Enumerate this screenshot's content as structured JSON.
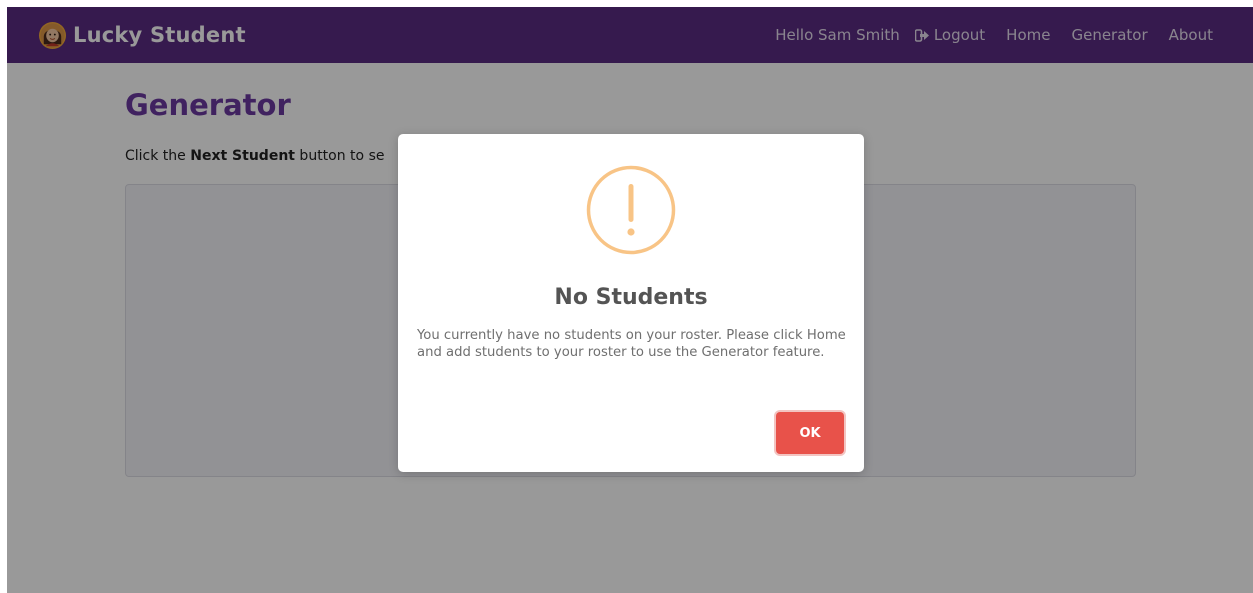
{
  "navbar": {
    "brand": "Lucky Student",
    "greeting": "Hello Sam Smith",
    "logout": "Logout",
    "links": [
      "Home",
      "Generator",
      "About"
    ],
    "background": "#5b2c83"
  },
  "page": {
    "title": "Generator",
    "instructions_prefix": "Click the ",
    "instructions_bold": "Next Student",
    "instructions_suffix": " button to se"
  },
  "modal": {
    "icon": "warning-icon",
    "icon_color": "#f8c486",
    "title": "No Students",
    "message": "You currently have no students on your roster. Please click Home and add students to your roster to use the Generator feature.",
    "ok_label": "OK",
    "ok_color": "#e8524a"
  }
}
